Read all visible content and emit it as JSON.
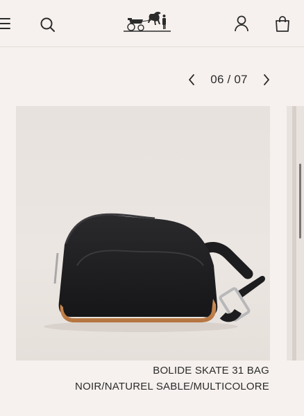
{
  "header": {
    "menu_icon": "hamburger-menu-icon",
    "search_icon": "search-icon",
    "logo_icon": "horse-carriage-logo",
    "account_icon": "user-account-icon",
    "bag_icon": "shopping-bag-icon"
  },
  "gallery": {
    "current": "06",
    "total": "07",
    "counter_text": "06 / 07",
    "prev_icon": "chevron-left-icon",
    "next_icon": "chevron-right-icon",
    "progress": 0.857
  },
  "product": {
    "name": "BOLIDE SKATE 31 BAG",
    "color": "NOIR/NATUREL SABLE/MULTICOLORE"
  },
  "colors": {
    "background": "#f6f1ee",
    "text": "#2b2b2b",
    "bag_body": "#1c1c1e",
    "bag_trim": "#c8864e"
  }
}
